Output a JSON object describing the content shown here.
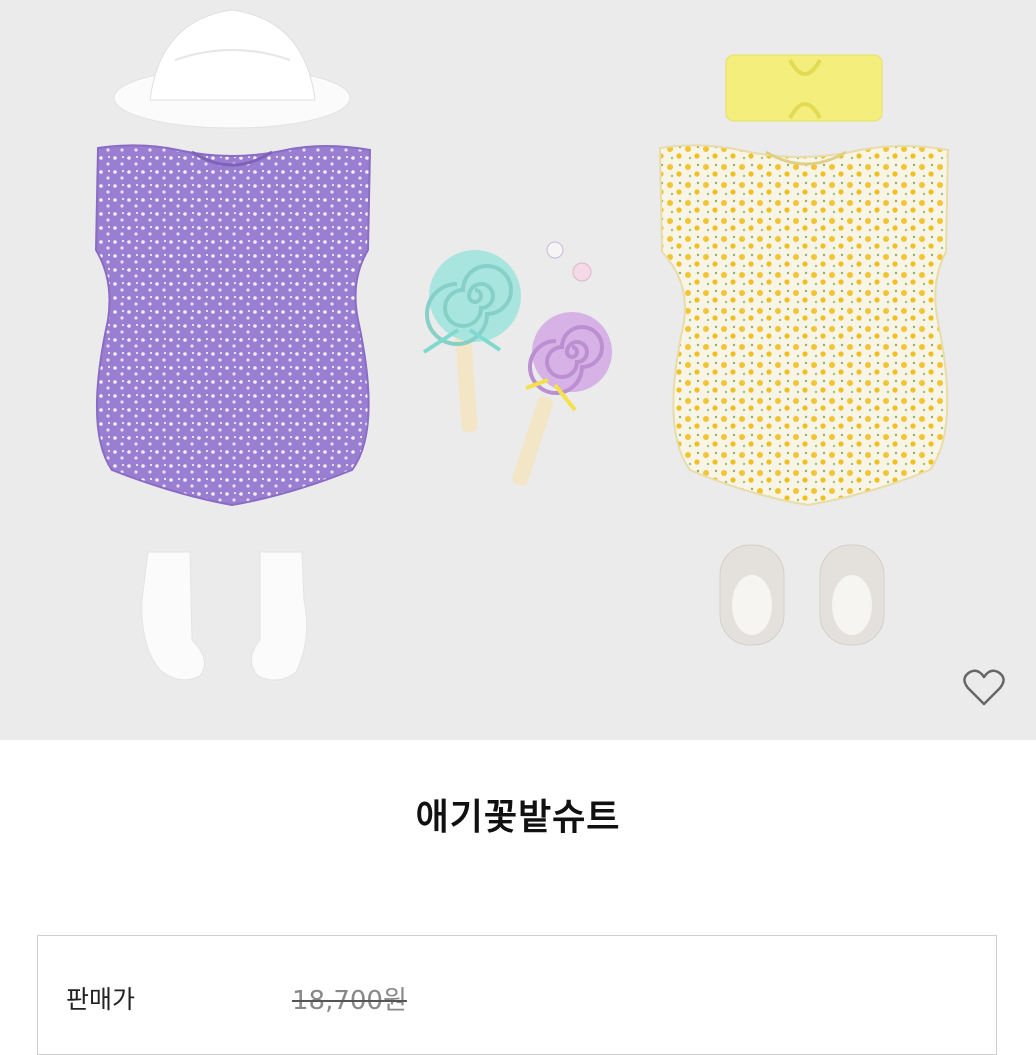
{
  "product": {
    "image_alt": "애기꽃밭슈트",
    "title": "애기꽃밭슈트"
  },
  "price": {
    "label": "판매가",
    "original": "18,700원"
  },
  "icons": {
    "wishlist": "heart-outline-icon"
  },
  "colors": {
    "background": "#ecebec",
    "lavender_romper": "#9b7fd2",
    "yellow_romper": "#f3e8a8",
    "headband": "#f5f07a"
  }
}
